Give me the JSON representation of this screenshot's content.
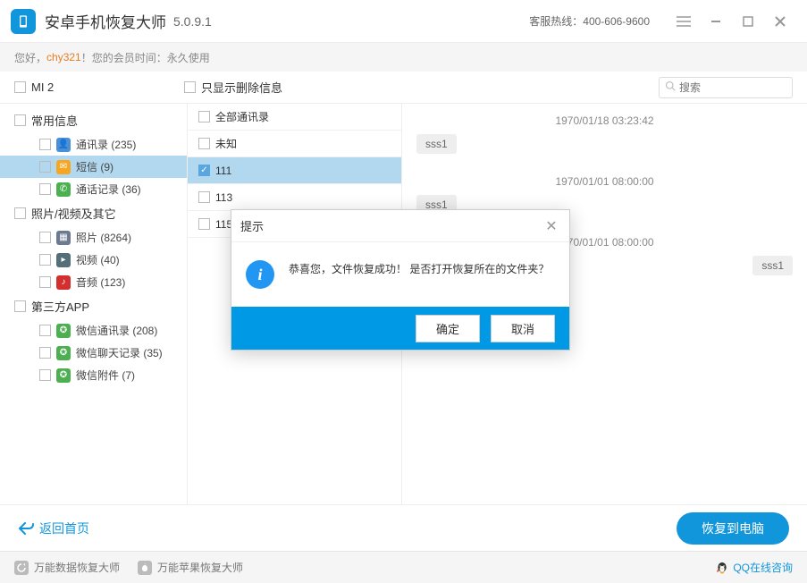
{
  "titlebar": {
    "app_name": "安卓手机恢复大师",
    "version": "5.0.9.1",
    "hotline": "客服热线：400-606-9600"
  },
  "userbar": {
    "prefix": "您好，",
    "username": "chy321",
    "suffix": "！您的会员时间：永久使用"
  },
  "toolbar": {
    "device_label": "MI 2",
    "only_deleted_label": "只显示删除信息",
    "search_placeholder": "搜索"
  },
  "sidebar": {
    "categories": [
      {
        "label": "常用信息",
        "items": [
          {
            "icon": "contacts",
            "label": "通讯录 (235)"
          },
          {
            "icon": "sms",
            "label": "短信 (9)",
            "selected": true
          },
          {
            "icon": "call",
            "label": "通话记录 (36)"
          }
        ]
      },
      {
        "label": "照片/视频及其它",
        "items": [
          {
            "icon": "photo",
            "label": "照片 (8264)"
          },
          {
            "icon": "video",
            "label": "视频 (40)"
          },
          {
            "icon": "audio",
            "label": "音频 (123)"
          }
        ]
      },
      {
        "label": "第三方APP",
        "items": [
          {
            "icon": "wx",
            "label": "微信通讯录 (208)"
          },
          {
            "icon": "wx",
            "label": "微信聊天记录 (35)"
          },
          {
            "icon": "wx",
            "label": "微信附件 (7)"
          }
        ]
      }
    ]
  },
  "midlist": {
    "rows": [
      {
        "label": "全部通讯录",
        "checked": false
      },
      {
        "label": "未知",
        "checked": false
      },
      {
        "label": "111",
        "checked": true,
        "selected": true
      },
      {
        "label": "113",
        "checked": false
      },
      {
        "label": "115",
        "checked": false
      }
    ]
  },
  "messages": [
    {
      "time": "1970/01/18 03:23:42",
      "text": "sss1",
      "align": "left"
    },
    {
      "time": "1970/01/01 08:00:00",
      "text": "sss1",
      "align": "left"
    },
    {
      "time": "1970/01/01 08:00:00",
      "text": "sss1",
      "align": "right"
    }
  ],
  "footer": {
    "back_label": "返回首页",
    "recover_label": "恢复到电脑"
  },
  "statusbar": {
    "item1": "万能数据恢复大师",
    "item2": "万能苹果恢复大师",
    "qq": "QQ在线咨询"
  },
  "modal": {
    "title": "提示",
    "message": "恭喜您，文件恢复成功！ 是否打开恢复所在的文件夹？",
    "ok": "确定",
    "cancel": "取消"
  }
}
